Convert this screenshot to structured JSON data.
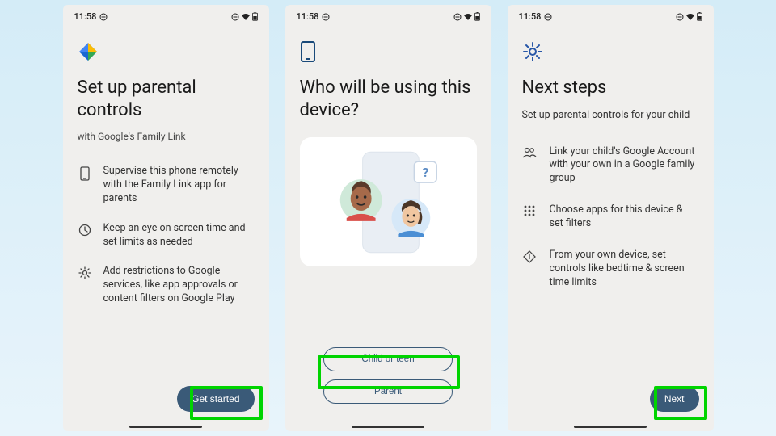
{
  "statusbar": {
    "time": "11:58"
  },
  "screen1": {
    "title": "Set up parental controls",
    "subtitle": "with Google's Family Link",
    "feature1": "Supervise this phone remotely with the Family Link app for parents",
    "feature2": "Keep an eye on screen time and set limits as needed",
    "feature3": "Add restrictions to Google services, like app approvals or content filters on Google Play",
    "cta": "Get started"
  },
  "screen2": {
    "title": "Who will be using this device?",
    "option_child": "Child or teen",
    "option_parent": "Parent"
  },
  "screen3": {
    "title": "Next steps",
    "subtitle": "Set up parental controls for your child",
    "step1": "Link your child's Google Account with your own in a Google family group",
    "step2": "Choose apps for this device & set filters",
    "step3": "From your own device, set controls like bedtime & screen time limits",
    "cta": "Next"
  }
}
